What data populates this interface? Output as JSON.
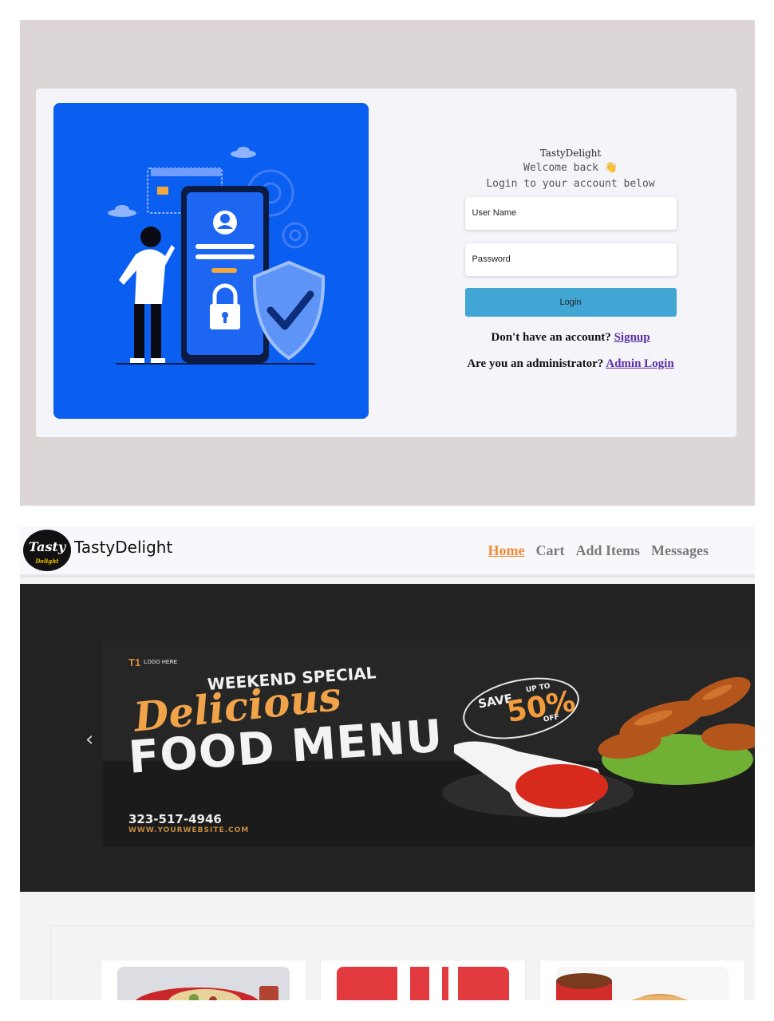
{
  "login": {
    "brand": "TastyDelight",
    "welcome": "Welcome back",
    "welcome_emoji": "👋",
    "subtitle": "Login to your account below",
    "username_placeholder": "User Name",
    "password_placeholder": "Password",
    "login_button": "Login",
    "signup_prompt": "Don't have an account?",
    "signup_link": "Signup",
    "admin_prompt": "Are you an administrator?",
    "admin_link": "Admin Login"
  },
  "home": {
    "logo_text": "Tasty",
    "logo_subtext": "Delight",
    "brand": "TastyDelight",
    "nav": [
      {
        "label": "Home",
        "active": true
      },
      {
        "label": "Cart",
        "active": false
      },
      {
        "label": "Add Items",
        "active": false
      },
      {
        "label": "Messages",
        "active": false
      }
    ],
    "carousel_prev": "‹",
    "banner": {
      "logo_mark": "T1",
      "logo_text": "LOGO HERE",
      "headline_small": "WEEKEND SPECIAL",
      "headline_script": "Delicious",
      "headline_big": "FOOD MENU",
      "save": "SAVE",
      "upto": "UP TO",
      "percent": "50%",
      "off": "OFF",
      "phone": "323-517-4946",
      "website": "WWW.YOURWEBSITE.COM"
    }
  },
  "colors": {
    "login_bg": "#ddd6d6",
    "illustration_bg": "#0a5ff0",
    "login_button": "#41a6d4",
    "link": "#5b2fa8",
    "nav_active": "#f18a33"
  }
}
